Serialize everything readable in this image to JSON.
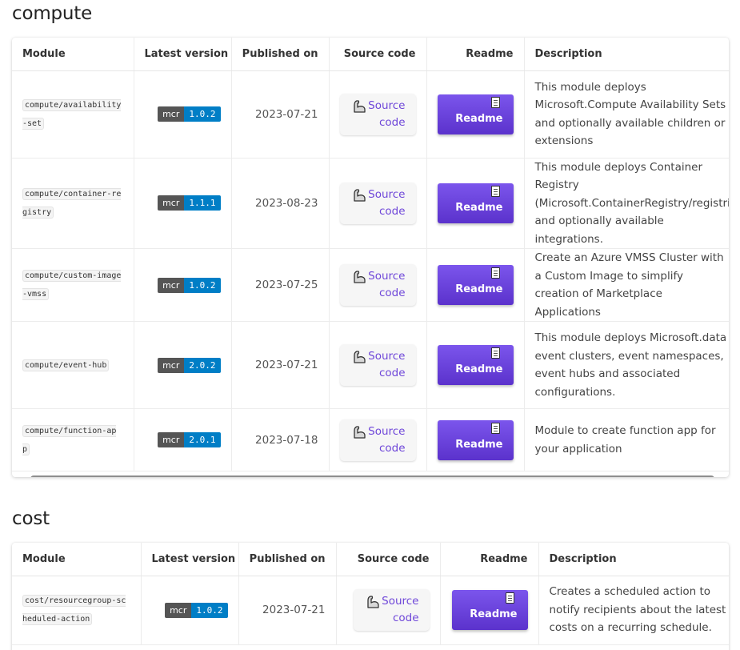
{
  "sections": [
    {
      "title": "compute",
      "headers": [
        "Module",
        "Latest version",
        "Published on",
        "Source code",
        "Readme",
        "Description"
      ],
      "rows": [
        {
          "module": "compute/availability-set",
          "badge_label": "mcr",
          "version": "1.0.2",
          "published": "2023-07-21",
          "source_label": "Source code",
          "readme_label": "Readme",
          "description": "This module deploys Microsoft.Compute Availability Sets and optionally available children or extensions"
        },
        {
          "module": "compute/container-registry",
          "badge_label": "mcr",
          "version": "1.1.1",
          "published": "2023-08-23",
          "source_label": "Source code",
          "readme_label": "Readme",
          "description": "This module deploys Container Registry (Microsoft.ContainerRegistry/registries) and optionally available integrations."
        },
        {
          "module": "compute/custom-image-vmss",
          "badge_label": "mcr",
          "version": "1.0.2",
          "published": "2023-07-25",
          "source_label": "Source code",
          "readme_label": "Readme",
          "description": "Create an Azure VMSS Cluster with a Custom Image to simplify creation of Marketplace Applications"
        },
        {
          "module": "compute/event-hub",
          "badge_label": "mcr",
          "version": "2.0.2",
          "published": "2023-07-21",
          "source_label": "Source code",
          "readme_label": "Readme",
          "description": "This module deploys Microsoft.data event clusters, event namespaces, event hubs and associated configurations."
        },
        {
          "module": "compute/function-app",
          "badge_label": "mcr",
          "version": "2.0.1",
          "published": "2023-07-18",
          "source_label": "Source code",
          "readme_label": "Readme",
          "description": "Module to create function app for your application"
        }
      ]
    },
    {
      "title": "cost",
      "headers": [
        "Module",
        "Latest version",
        "Published on",
        "Source code",
        "Readme",
        "Description"
      ],
      "rows": [
        {
          "module": "cost/resourcegroup-scheduled-action",
          "badge_label": "mcr",
          "version": "1.0.2",
          "published": "2023-07-21",
          "source_label": "Source code",
          "readme_label": "Readme",
          "description": "Creates a scheduled action to notify recipients about the latest costs on a recurring schedule."
        }
      ]
    }
  ],
  "colors": {
    "badge_left": "#555555",
    "badge_right": "#007ec6",
    "readme_button": "#6a42dd",
    "source_link": "#6f47d9"
  },
  "icons": {
    "source": "arm-flex-icon",
    "readme": "document-icon"
  }
}
